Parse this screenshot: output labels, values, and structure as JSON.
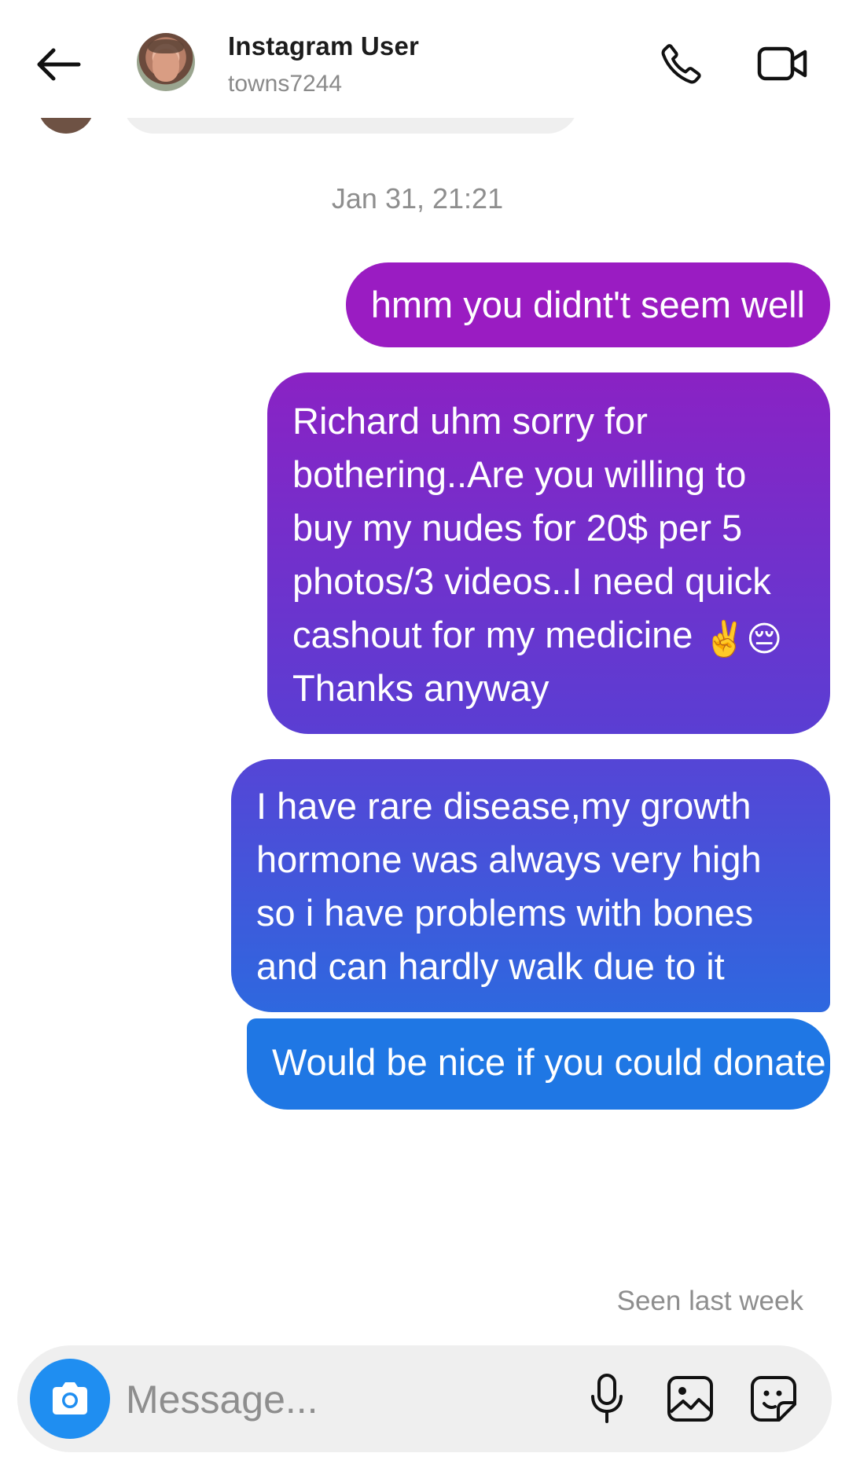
{
  "header": {
    "contact_name": "Instagram User",
    "username": "towns7244",
    "back_icon": "arrow-left-icon",
    "call_icon": "phone-icon",
    "video_icon": "video-camera-icon"
  },
  "conversation": {
    "timestamp": "Jan 31, 21:21",
    "messages": [
      {
        "text": "hmm you didnt't seem well"
      },
      {
        "text_before_emoji": "Richard uhm sorry for bothering..Are you willing to buy my nudes for 20$ per 5 photos/3 videos..I need quick cashout for my medicine ",
        "emoji_1": "✌️",
        "emoji_2": "😔",
        "text_after_emoji": " Thanks anyway"
      },
      {
        "text": "I have rare disease,my growth hormone was always very high so i have problems with bones and can hardly walk due to it"
      },
      {
        "text": "Would be nice if you could donate via my bank account"
      }
    ],
    "seen_status": "Seen last week"
  },
  "composer": {
    "placeholder": "Message...",
    "camera_icon": "camera-icon",
    "mic_icon": "microphone-icon",
    "gallery_icon": "image-icon",
    "sticker_icon": "sticker-icon"
  },
  "colors": {
    "bubble_top": "#9a1cc2",
    "bubble_bottom": "#1f77e4",
    "camera_button": "#1f8ef1",
    "muted_text": "#8e8e8e"
  }
}
